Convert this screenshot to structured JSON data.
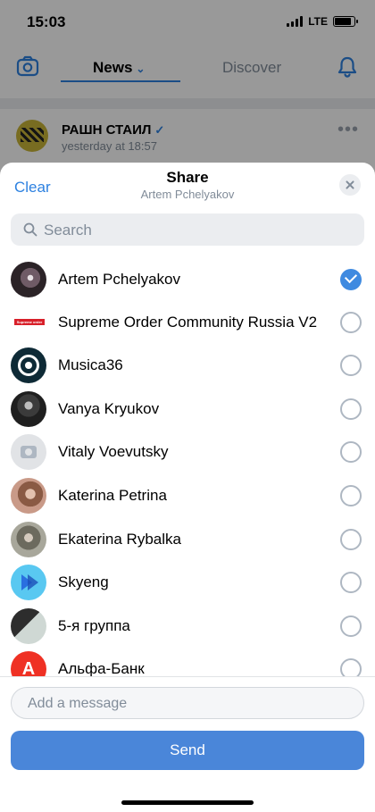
{
  "status_bar": {
    "time": "15:03",
    "network": "LTE",
    "battery_percent": 85
  },
  "app_header": {
    "tabs": [
      {
        "label": "News",
        "active": true
      },
      {
        "label": "Discover",
        "active": false
      }
    ]
  },
  "feed_post": {
    "author": "РАШН СТАИЛ",
    "time": "yesterday at 18:57"
  },
  "share_sheet": {
    "clear_label": "Clear",
    "title": "Share",
    "subtitle": "Artem Pchelyakov",
    "search_placeholder": "Search",
    "contacts": [
      {
        "name": "Artem Pchelyakov",
        "selected": true
      },
      {
        "name": "Supreme Order Community Russia V2",
        "selected": false
      },
      {
        "name": "Musica36",
        "selected": false
      },
      {
        "name": "Vanya Kryukov",
        "selected": false
      },
      {
        "name": "Vitaly Voevutsky",
        "selected": false
      },
      {
        "name": "Katerina Petrina",
        "selected": false
      },
      {
        "name": "Ekaterina Rybalka",
        "selected": false
      },
      {
        "name": "Skyeng",
        "selected": false
      },
      {
        "name": "5-я группа",
        "selected": false
      },
      {
        "name": "Альфа-Банк",
        "selected": false
      }
    ],
    "message_placeholder": "Add a message",
    "send_label": "Send",
    "supreme_logo_text": "Supreme order",
    "alfa_logo_letter": "A"
  },
  "colors": {
    "accent": "#2d81e0",
    "send_button": "#4a86d9",
    "alfa_red": "#ef3124"
  }
}
